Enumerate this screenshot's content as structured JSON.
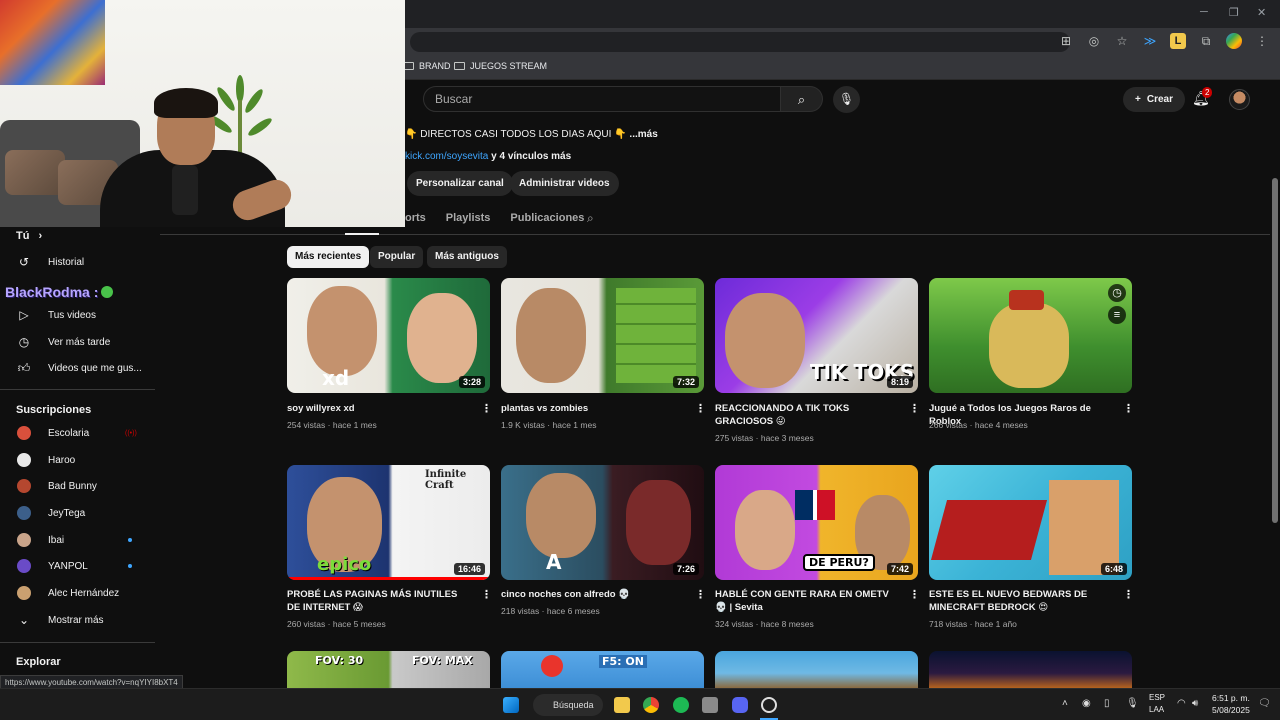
{
  "window": {
    "minimize": "─",
    "restore": "❐",
    "close": "✕"
  },
  "bookmarks": [
    {
      "label": "BRAND"
    },
    {
      "label": "JUEGOS STREAM"
    }
  ],
  "header": {
    "search_placeholder": "Buscar",
    "create_label": "Crear",
    "notification_count": "2"
  },
  "channel": {
    "description": "DIRECTOS CASI TODOS LOS DIAS AQUI",
    "description_more": "...más",
    "link": "kick.com/soysevita",
    "link_more": " y 4 vínculos más",
    "buttons": [
      "Personalizar canal",
      "Administrar videos"
    ],
    "tabs": [
      "orts",
      "Playlists",
      "Publicaciones"
    ]
  },
  "filters": [
    "Más recientes",
    "Popular",
    "Más antiguos"
  ],
  "sidebar": {
    "you_heading": "Tú",
    "you_items": [
      {
        "label": "Historial",
        "icon": "history-icon"
      },
      {
        "label": "Tus videos",
        "icon": "your-videos-icon"
      },
      {
        "label": "Ver más tarde",
        "icon": "watch-later-icon"
      },
      {
        "label": "Videos que me gus...",
        "icon": "like-icon"
      }
    ],
    "subs_heading": "Suscripciones",
    "subscriptions": [
      {
        "label": "Escolaria",
        "color": "#d9503c",
        "badge": "live"
      },
      {
        "label": "Haroo",
        "color": "#e8e8e8",
        "badge": ""
      },
      {
        "label": "Bad Bunny",
        "color": "#b5472f",
        "badge": ""
      },
      {
        "label": "JeyTega",
        "color": "#3c5f8a",
        "badge": ""
      },
      {
        "label": "Ibai",
        "color": "#c9a48a",
        "badge": "dot"
      },
      {
        "label": "YANPOL",
        "color": "#6a4bc7",
        "badge": "dot"
      },
      {
        "label": "Alec Hernández",
        "color": "#caa070",
        "badge": ""
      }
    ],
    "show_more": "Mostrar más",
    "explore_heading": "Explorar"
  },
  "overlay": {
    "username": "BlackRodma :"
  },
  "videos": [
    {
      "title": "soy willyrex xd",
      "views": "254 vistas",
      "age": "hace 1 mes",
      "duration": "3:28",
      "thumb_text": "xd"
    },
    {
      "title": "plantas vs zombies",
      "views": "1.9 K vistas",
      "age": "hace 1 mes",
      "duration": "7:32",
      "thumb_text": ""
    },
    {
      "title": "REACCIONANDO A TIK TOKS GRACIOSOS 😜",
      "views": "275 vistas",
      "age": "hace 3 meses",
      "duration": "8:19",
      "thumb_text": "TIK TOKS"
    },
    {
      "title": "Jugué a Todos los Juegos Raros de Roblox",
      "views": "266 vistas",
      "age": "hace 4 meses",
      "duration": "",
      "thumb_text": ""
    },
    {
      "title": "PROBÉ LAS PAGINAS MÁS INUTILES DE INTERNET 😱",
      "views": "260 vistas",
      "age": "hace 5 meses",
      "duration": "16:46",
      "thumb_text": "epico"
    },
    {
      "title": "cinco noches con alfredo 💀",
      "views": "218 vistas",
      "age": "hace 6 meses",
      "duration": "7:26",
      "thumb_text": "A"
    },
    {
      "title": "HABLÉ CON GENTE RARA EN OMETV 💀 | Sevita",
      "views": "324 vistas",
      "age": "hace 8 meses",
      "duration": "7:42",
      "thumb_text": "DE PERU?"
    },
    {
      "title": "ESTE ES EL NUEVO BEDWARS DE MINECRAFT BEDROCK 😍",
      "views": "718 vistas",
      "age": "hace 1 año",
      "duration": "6:48",
      "thumb_text": ""
    }
  ],
  "thumb_extra": {
    "infinite_craft": "Infinite Craft",
    "fov1": "FOV: 30",
    "fov2": "FOV: MAX",
    "f5": "F5: ON"
  },
  "status_url": "https://www.youtube.com/watch?v=nqYIYI8bXT4",
  "taskbar": {
    "search_label": "Búsqueda",
    "lang_top": "ESP",
    "lang_bottom": "LAA",
    "time": "6:51 p. m.",
    "date": "5/08/2025"
  }
}
